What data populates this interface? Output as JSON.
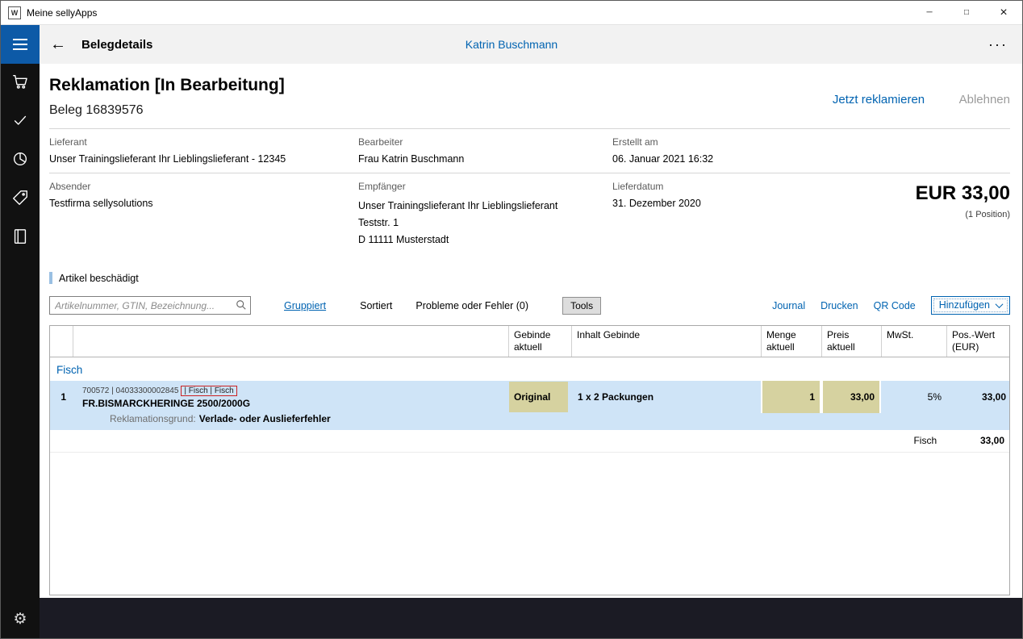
{
  "colors": {
    "accent_blue": "#0063b1",
    "row_highlight_blue": "#cfe4f7",
    "cell_highlight_khaki": "#d6d2a0",
    "alert_red": "#cc2222",
    "sidebar_dark": "#111111",
    "bottom_strip_dark": "#1b1b24"
  },
  "icons": {
    "back": "←",
    "ellipsis": "···",
    "minimize": "─",
    "maximize": "□",
    "close": "×",
    "gear": "⚙",
    "app_initial": "W"
  },
  "titlebar": {
    "title": "Meine sellyApps"
  },
  "header": {
    "title": "Belegdetails",
    "user": "Katrin Buschmann"
  },
  "document": {
    "title": "Reklamation [In Bearbeitung]",
    "subtitle": "Beleg 16839576",
    "actions": {
      "primary": "Jetzt reklamieren",
      "secondary": "Ablehnen"
    },
    "info": {
      "lieferant": {
        "label": "Lieferant",
        "value": "Unser Trainingslieferant Ihr Lieblingslieferant - 12345"
      },
      "bearbeiter": {
        "label": "Bearbeiter",
        "value": "Frau Katrin Buschmann"
      },
      "erstellt": {
        "label": "Erstellt am",
        "value": "06. Januar 2021 16:32"
      },
      "absender": {
        "label": "Absender",
        "value": "Testfirma sellysolutions"
      },
      "empfaenger": {
        "label": "Empfänger",
        "lines": [
          "Unser Trainingslieferant Ihr Lieblingslieferant",
          "Teststr. 1",
          "D 11111 Musterstadt"
        ]
      },
      "lieferdatum": {
        "label": "Lieferdatum",
        "value": "31. Dezember 2020"
      }
    },
    "total": {
      "amount": "EUR 33,00",
      "positions": "(1 Position)"
    },
    "note": "Artikel beschädigt"
  },
  "toolbar": {
    "search_placeholder": "Artikelnummer, GTIN, Bezeichnung...",
    "gruppiert": "Gruppiert",
    "sortiert": "Sortiert",
    "probleme": "Probleme oder Fehler (0)",
    "tools": "Tools",
    "journal": "Journal",
    "drucken": "Drucken",
    "qr_code": "QR Code",
    "hinzufuegen": "Hinzufügen"
  },
  "table": {
    "headers": [
      "",
      "",
      "Gebinde aktuell",
      "Inhalt Gebinde",
      "Menge aktuell",
      "Preis aktuell",
      "MwSt.",
      "Pos.-Wert (EUR)"
    ],
    "group": "Fisch",
    "row": {
      "pos": "1",
      "meta": "700572 | 04033300002845",
      "meta_highlight": "| Fisch | Fisch",
      "name": "FR.BISMARCKHERINGE 2500/2000G",
      "gebinde": "Original",
      "inhalt": "1 x 2 Packungen",
      "menge": "1",
      "preis": "33,00",
      "mwst": "5%",
      "pos_wert": "33,00",
      "grund_label": "Reklamationsgrund:",
      "grund_value": "Verlade- oder Auslieferfehler"
    },
    "summary": {
      "group": "Fisch",
      "value": "33,00"
    }
  }
}
